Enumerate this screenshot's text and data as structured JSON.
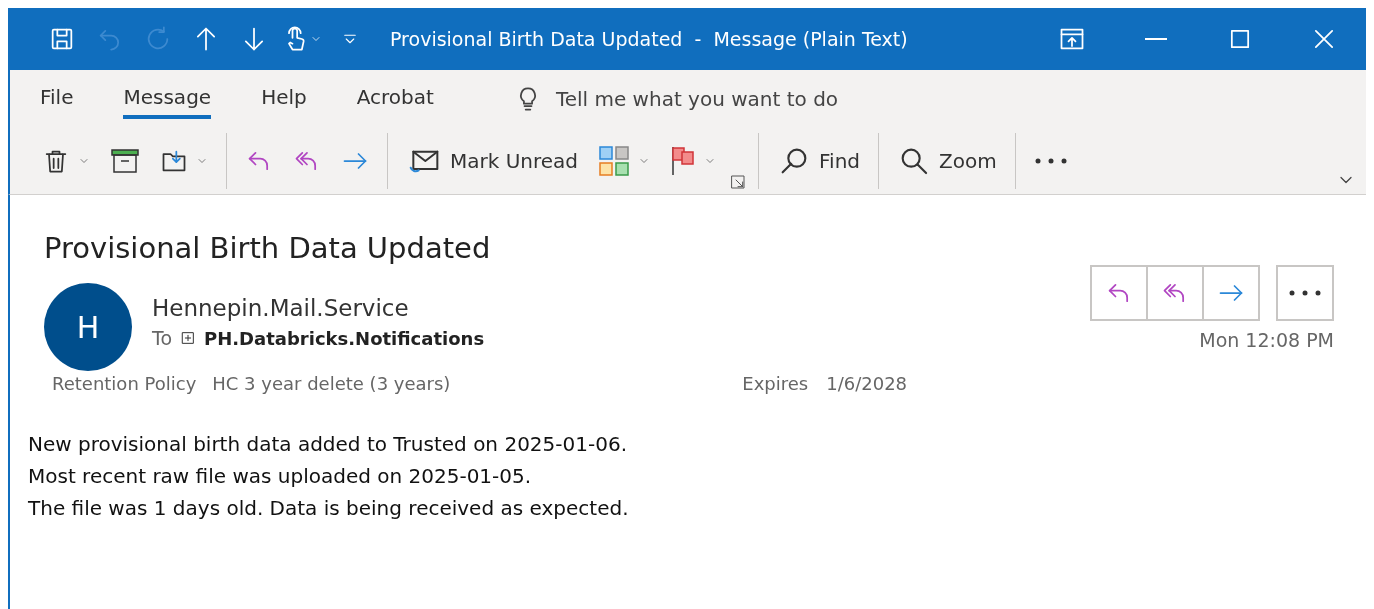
{
  "window": {
    "title": "Provisional Birth Data Updated  -  Message (Plain Text)"
  },
  "quick_access": [
    {
      "kind": "save",
      "disabled": false
    },
    {
      "kind": "undo",
      "disabled": true
    },
    {
      "kind": "redo",
      "disabled": true
    },
    {
      "kind": "up",
      "disabled": false
    },
    {
      "kind": "down",
      "disabled": false
    },
    {
      "kind": "touch",
      "disabled": false
    },
    {
      "kind": "customize",
      "disabled": false
    }
  ],
  "tabs": [
    {
      "label": "File",
      "selected": false
    },
    {
      "label": "Message",
      "selected": true
    },
    {
      "label": "Help",
      "selected": false
    },
    {
      "label": "Acrobat",
      "selected": false
    }
  ],
  "tell_me": {
    "placeholder": "Tell me what you want to do"
  },
  "toolbar": [
    {
      "kind": "delete"
    },
    {
      "kind": "archive"
    },
    {
      "kind": "move"
    },
    {
      "kind": "separator"
    },
    {
      "kind": "reply"
    },
    {
      "kind": "reply_all"
    },
    {
      "kind": "forward"
    },
    {
      "kind": "separator"
    },
    {
      "kind": "mark_unread",
      "label": "Mark Unread"
    },
    {
      "kind": "categorize"
    },
    {
      "kind": "flag"
    },
    {
      "kind": "launcher"
    },
    {
      "kind": "separator"
    },
    {
      "kind": "find",
      "label": "Find"
    },
    {
      "kind": "separator"
    },
    {
      "kind": "zoom",
      "label": "Zoom"
    },
    {
      "kind": "separator"
    },
    {
      "kind": "more"
    }
  ],
  "message": {
    "subject": "Provisional Birth Data Updated",
    "avatar_initial": "H",
    "sender": "Hennepin.Mail.Service",
    "to_label": "To",
    "recipient": "PH.Databricks.Notifications",
    "time": "Mon 12:08 PM",
    "retention_label": "Retention Policy",
    "retention_value": "HC 3 year delete (3 years)",
    "expires_label": "Expires",
    "expires_value": "1/6/2028",
    "body": [
      "New provisional birth data added to Trusted on 2025-01-06.",
      "Most recent raw file was uploaded on 2025-01-05.",
      "The file was 1 days old. Data is being received as expected."
    ]
  }
}
